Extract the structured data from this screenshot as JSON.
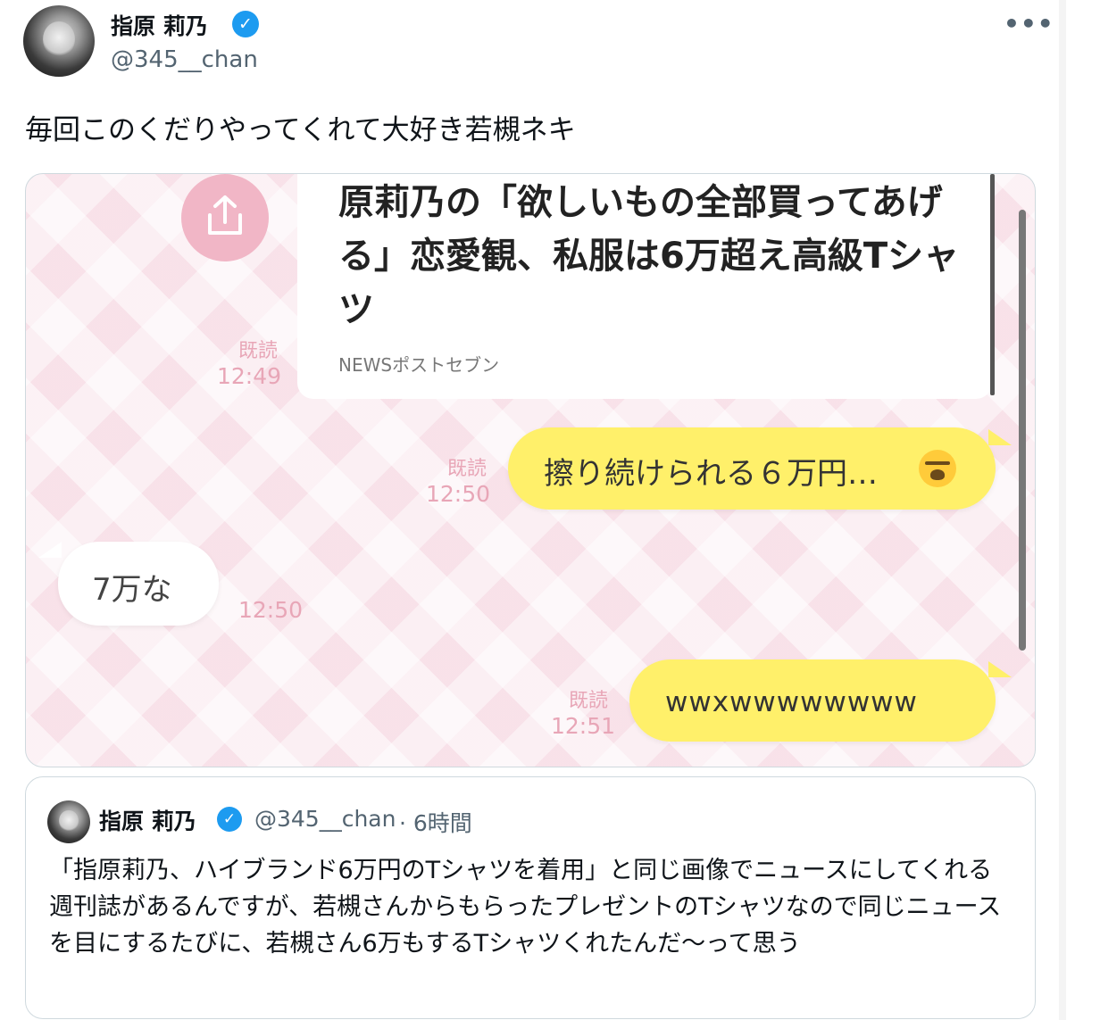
{
  "tweet": {
    "author": {
      "name": "指原 莉乃",
      "handle": "@345__chan",
      "verified": true
    },
    "more_label": "•••",
    "text": "毎回このくだりやってくれて大好き若槻ネキ",
    "media": {
      "news_card": {
        "title": "原莉乃の「欲しいもの全部買ってあげる」恋愛観、私服は6万超え高級Tシャツ",
        "source": "NEWSポストセブン",
        "read": "既読",
        "time": "12:49"
      },
      "messages": [
        {
          "side": "right",
          "text": "擦り続けられる６万円…",
          "emoji": "loudly-crying-face",
          "read": "既読",
          "time": "12:50"
        },
        {
          "side": "left",
          "text": "7万な",
          "time": "12:50"
        },
        {
          "side": "right",
          "text": "wwxwwwwwwww",
          "read": "既読",
          "time": "12:51"
        }
      ]
    }
  },
  "quoted_tweet": {
    "author": {
      "name": "指原 莉乃",
      "handle": "@345__chan",
      "verified": true,
      "age": "· 6時間"
    },
    "text": "「指原莉乃、ハイブランド6万円のTシャツを着用」と同じ画像でニュースにしてくれる週刊誌があるんですが、若槻さんからもらったプレゼントのTシャツなので同じニュースを目にするたびに、若槻さん6万もするTシャツくれたんだ〜って思う"
  },
  "colors": {
    "verified": "#1d9bf0",
    "bubble_yellow": "#fff06a",
    "timestamp_pink": "#e8a6b7",
    "chat_bg": "#fbeff3"
  }
}
